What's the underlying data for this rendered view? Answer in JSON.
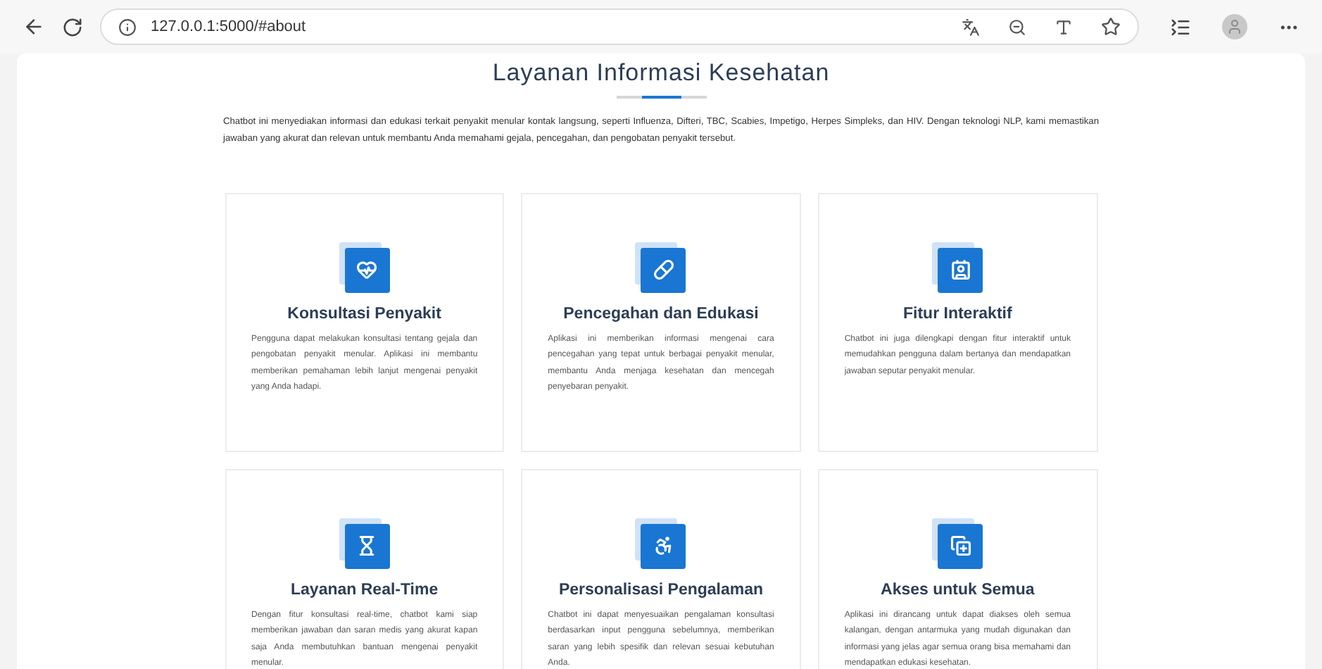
{
  "browser": {
    "url": "127.0.0.1:5000/#about"
  },
  "page": {
    "title": "Layanan Informasi Kesehatan",
    "intro": "Chatbot ini menyediakan informasi dan edukasi terkait penyakit menular kontak langsung, seperti Influenza, Difteri, TBC, Scabies, Impetigo, Herpes Simpleks, dan HIV. Dengan teknologi NLP, kami memastikan jawaban yang akurat dan relevan untuk membantu Anda memahami gejala, pencegahan, dan pengobatan penyakit tersebut."
  },
  "cards": [
    {
      "kind": "heart",
      "title": "Konsultasi Penyakit",
      "text": "Pengguna dapat melakukan konsultasi tentang gejala dan pengobatan penyakit menular. Aplikasi ini membantu memberikan pemahaman lebih lanjut mengenai penyakit yang Anda hadapi."
    },
    {
      "kind": "pill",
      "title": "Pencegahan dan Edukasi",
      "text": "Aplikasi ini memberikan informasi mengenai cara pencegahan yang tepat untuk berbagai penyakit menular, membantu Anda menjaga kesehatan dan mencegah penyebaran penyakit."
    },
    {
      "kind": "contact",
      "title": "Fitur Interaktif",
      "text": "Chatbot ini juga dilengkapi dengan fitur interaktif untuk memudahkan pengguna dalam bertanya dan mendapatkan jawaban seputar penyakit menular."
    },
    {
      "kind": "hourglass",
      "title": "Layanan Real-Time",
      "text": "Dengan fitur konsultasi real-time, chatbot kami siap memberikan jawaban dan saran medis yang akurat kapan saja Anda membutuhkan bantuan mengenai penyakit menular."
    },
    {
      "kind": "wheelchair",
      "title": "Personalisasi Pengalaman",
      "text": "Chatbot ini dapat menyesuaikan pengalaman konsultasi berdasarkan input pengguna sebelumnya, memberikan saran yang lebih spesifik dan relevan sesuai kebutuhan Anda."
    },
    {
      "kind": "copyplus",
      "title": "Akses untuk Semua",
      "text": "Aplikasi ini dirancang untuk dapat diakses oleh semua kalangan, dengan antarmuka yang mudah digunakan dan informasi yang jelas agar semua orang bisa memahami dan mendapatkan edukasi kesehatan."
    }
  ]
}
